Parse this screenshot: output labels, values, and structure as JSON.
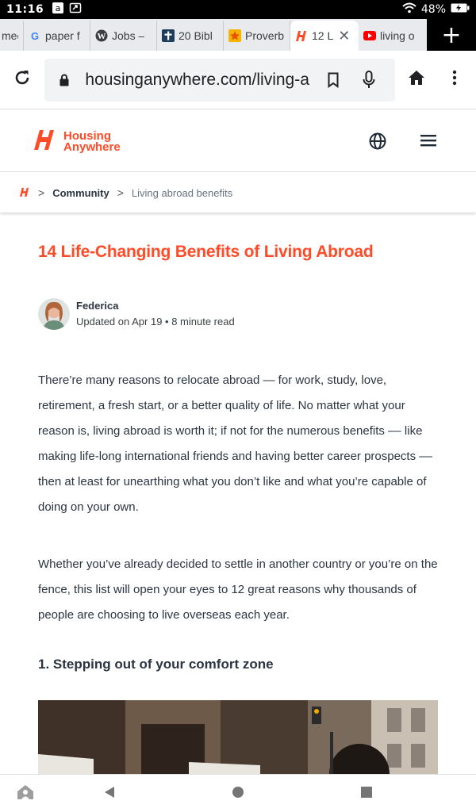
{
  "status_bar": {
    "time": "11:16",
    "battery": "48%"
  },
  "tabs": [
    {
      "label": "mec",
      "favicon": "generic-icon"
    },
    {
      "label": "paper f",
      "favicon": "google-icon"
    },
    {
      "label": "Jobs –",
      "favicon": "wordpress-icon"
    },
    {
      "label": "20 Bibl",
      "favicon": "cross-icon"
    },
    {
      "label": "Proverb",
      "favicon": "star-icon"
    },
    {
      "label": "12 L",
      "favicon": "housing-icon",
      "active": true
    },
    {
      "label": "living o",
      "favicon": "youtube-icon"
    }
  ],
  "toolbar": {
    "url": "housinganywhere.com/living-a"
  },
  "site": {
    "logo_line1": "Housing",
    "logo_line2": "Anywhere",
    "brand_color": "#ff4b27"
  },
  "breadcrumb": {
    "community": "Community",
    "current": "Living abroad benefits"
  },
  "article": {
    "title": "14 Life-Changing Benefits of Living Abroad",
    "author": "Federica",
    "meta": "Updated on Apr 19 • 8 minute read",
    "paragraph1": "There’re many reasons to relocate abroad — for work, study, love, retirement, a fresh start, or a better quality of life. No matter what your reason is, living abroad is worth it; if not for the numerous benefits –– like making life-long international friends and having better career prospects –– then at least for unearthing what you don’t like and what you’re capable of doing on your own.",
    "paragraph2": "Whether you’ve already decided to settle in another country or you’re on the fence, this list will open your eyes to 12 great reasons why thousands of people are choosing to live overseas each year.",
    "section1": "1. Stepping out of your comfort zone"
  }
}
